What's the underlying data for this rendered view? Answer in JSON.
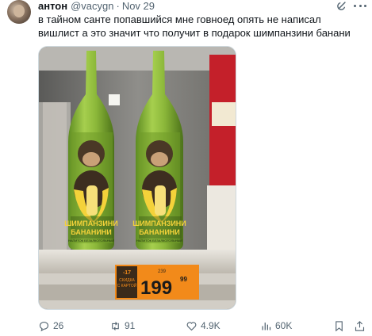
{
  "tweet": {
    "author_name": "антон",
    "handle": "@vacygn",
    "separator": "·",
    "date": "Nov 29",
    "text": "в тайном санте попавшийся мне говноед опять не написал вишлист а это значит что получит в подарок шимпанзини банани"
  },
  "media": {
    "label_line1": "ШИМПАНЗИНИ",
    "label_line2": "БАНАНИНИ",
    "label_arc": "ШИМПАНЗИНИ БАНАНИНИ",
    "label_small": "НАПИТОК БЕЗАЛКОГОЛЬНЫЙ",
    "price_badge_line1": "-17",
    "price_badge_line2": "СКИДКА",
    "price_badge_line3": "С КАРТОЙ",
    "price_old": "239",
    "price_new": "199",
    "price_cents": "99"
  },
  "actions": {
    "replies": "26",
    "reposts": "91",
    "likes": "4.9K",
    "views": "60K"
  },
  "colors": {
    "text_primary": "#0f1419",
    "text_secondary": "#536471",
    "border": "#cfd9de",
    "bottle_green": "#8cb83a",
    "price_orange": "#f28a1a"
  }
}
